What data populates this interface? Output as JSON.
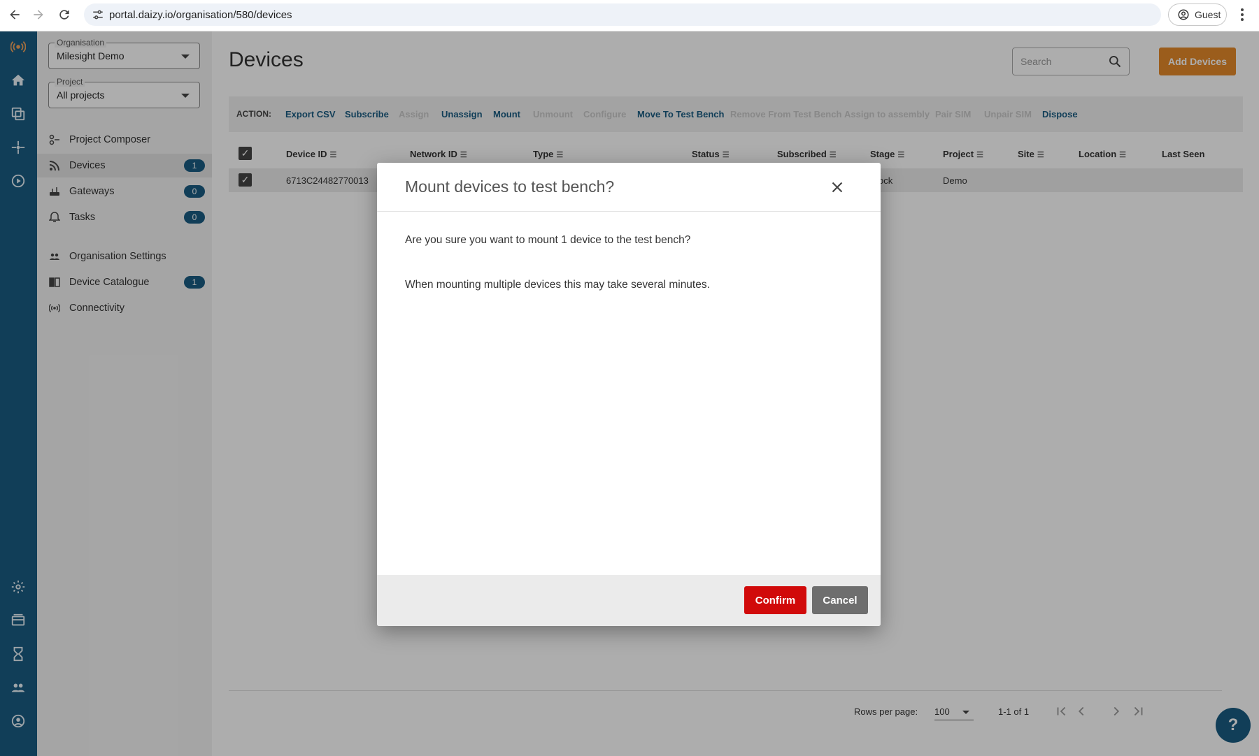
{
  "browser": {
    "url": "portal.daizy.io/organisation/580/devices",
    "profile_label": "Guest"
  },
  "colors": {
    "rail": "#1a5c82",
    "accent_orange": "#e5892a",
    "confirm_red": "#d10a0a",
    "cancel_grey": "#6e6e6e",
    "link_blue": "#1a5c82"
  },
  "rail": {
    "icons": [
      "logo-broadcast-icon",
      "home-icon",
      "devices-icon",
      "network-icon",
      "play-icon",
      "gear-icon",
      "catalogue-icon",
      "hourglass-icon",
      "people-icon",
      "account-icon"
    ]
  },
  "sidebar": {
    "organisation": {
      "label": "Organisation",
      "value": "Milesight Demo"
    },
    "project": {
      "label": "Project",
      "value": "All projects"
    },
    "items": [
      {
        "label": "Project Composer",
        "icon": "composer-icon",
        "badge": ""
      },
      {
        "label": "Devices",
        "icon": "devices-signal-icon",
        "badge": "1"
      },
      {
        "label": "Gateways",
        "icon": "gateway-icon",
        "badge": "0"
      },
      {
        "label": "Tasks",
        "icon": "bell-icon",
        "badge": "0"
      },
      {
        "label": "Organisation Settings",
        "icon": "people-icon",
        "badge": ""
      },
      {
        "label": "Device Catalogue",
        "icon": "book-icon",
        "badge": "1"
      },
      {
        "label": "Connectivity",
        "icon": "antenna-icon",
        "badge": ""
      }
    ]
  },
  "main": {
    "title": "Devices",
    "search_placeholder": "Search",
    "add_button": "Add Devices",
    "action_label": "ACTION:",
    "actions": [
      {
        "label": "Export CSV",
        "enabled": true
      },
      {
        "label": "Subscribe",
        "enabled": true
      },
      {
        "label": "Assign",
        "enabled": false
      },
      {
        "label": "Unassign",
        "enabled": true
      },
      {
        "label": "Mount",
        "enabled": true
      },
      {
        "label": "Unmount",
        "enabled": false
      },
      {
        "label": "Configure",
        "enabled": false
      },
      {
        "label": "Move To Test Bench",
        "enabled": true
      },
      {
        "label": "Remove From Test Bench",
        "enabled": false
      },
      {
        "label": "Assign to assembly",
        "enabled": false
      },
      {
        "label": "Pair SIM",
        "enabled": false
      },
      {
        "label": "Unpair SIM",
        "enabled": false
      },
      {
        "label": "Dispose",
        "enabled": true
      }
    ],
    "columns": [
      "Device ID",
      "Network ID",
      "Type",
      "Status",
      "Subscribed",
      "Stage",
      "Project",
      "Site",
      "Location",
      "Last Seen"
    ],
    "rows": [
      {
        "device_id": "6713C24482770013",
        "stage": "ock",
        "project": "Demo"
      }
    ],
    "pagination": {
      "rows_per_page_label": "Rows per page:",
      "rows_per_page": "100",
      "range": "1-1 of 1"
    },
    "help_label": "?"
  },
  "dialog": {
    "title": "Mount devices to test bench?",
    "message_1": "Are you sure you want to mount 1 device to the test bench?",
    "message_2": "When mounting multiple devices this may take several minutes.",
    "confirm_label": "Confirm",
    "cancel_label": "Cancel"
  }
}
